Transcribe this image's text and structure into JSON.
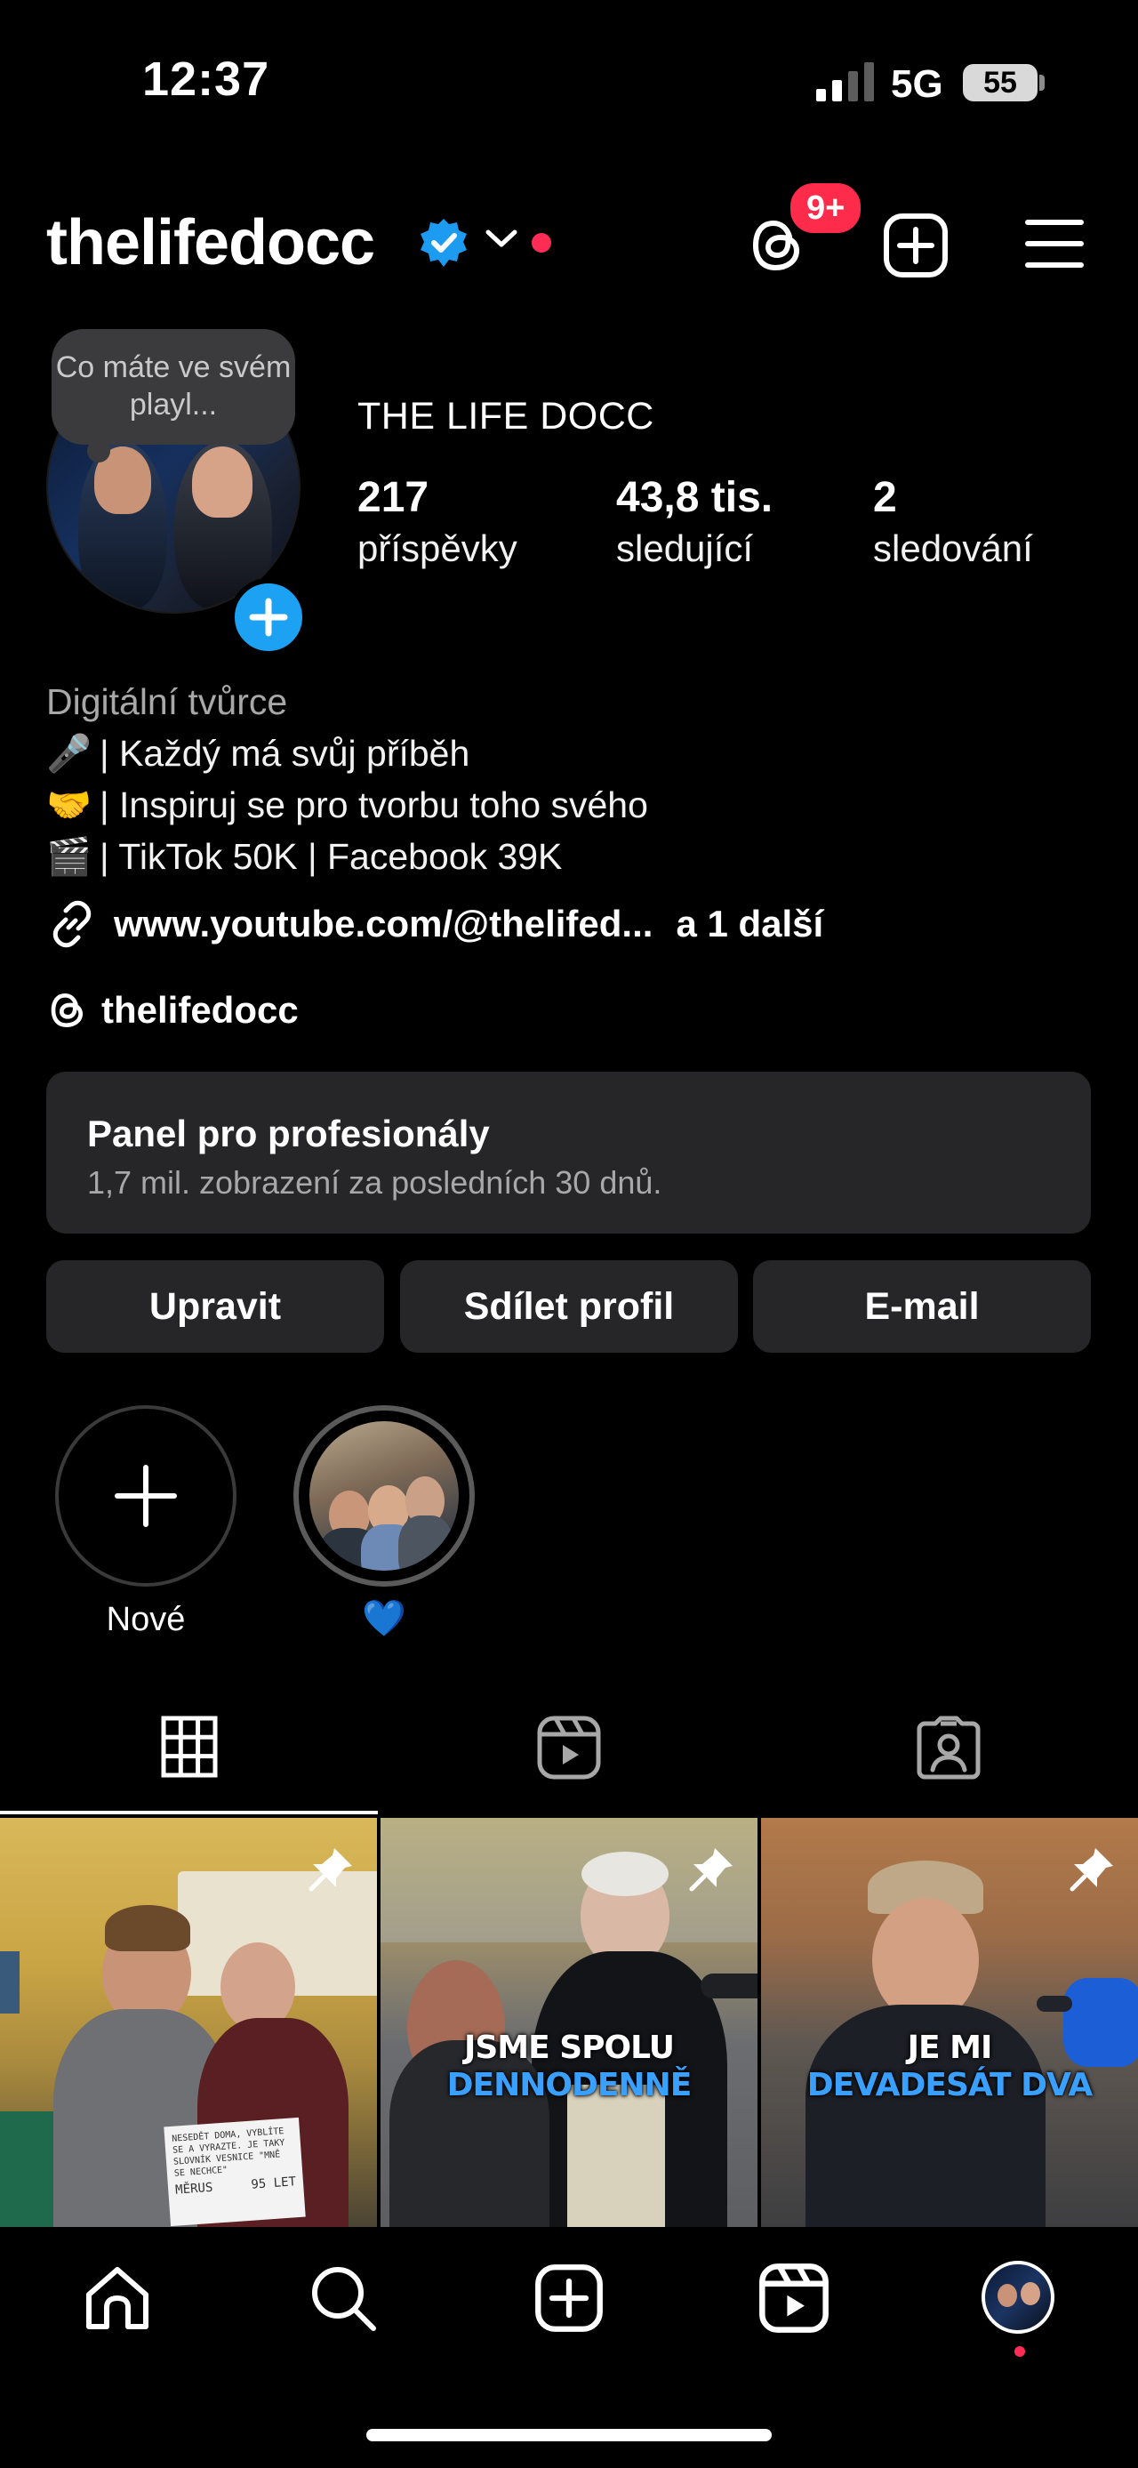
{
  "status_bar": {
    "time": "12:37",
    "network": "5G",
    "battery": "55"
  },
  "header": {
    "username": "thelifedocc",
    "notifications_badge": "9+"
  },
  "profile": {
    "note": "Co máte ve svém playl...",
    "display_name": "THE LIFE DOCC",
    "stats": [
      {
        "value": "217",
        "label": "příspěvky"
      },
      {
        "value": "43,8 tis.",
        "label": "sledující"
      },
      {
        "value": "2",
        "label": "sledování"
      }
    ]
  },
  "bio": {
    "category": "Digitální tvůrce",
    "lines": [
      {
        "emoji": "🎤",
        "text": "| Každý má svůj příběh"
      },
      {
        "emoji": "🤝",
        "text": "| Inspiruj se pro tvorbu toho svého"
      },
      {
        "emoji": "🎬",
        "text": "| TikTok 50K | Facebook 39K"
      }
    ],
    "link": "www.youtube.com/@thelifed...",
    "link_more": "a 1 další",
    "threads_handle": "thelifedocc"
  },
  "pro_panel": {
    "title": "Panel pro profesionály",
    "subtitle": "1,7 mil. zobrazení za posledních 30 dnů."
  },
  "buttons": {
    "edit": "Upravit",
    "share": "Sdílet profil",
    "email": "E-mail"
  },
  "highlights": [
    {
      "label": "Nové"
    },
    {
      "label": "💙"
    }
  ],
  "posts": [
    {
      "caption_top": "",
      "caption_bottom": "",
      "sign_text": "NESEDĚT DOMA, VYBLÍTE SE A VYRAZTE. JE TAKY SLOVNÍK VESNICE \"MNĚ SE NECHCE\"",
      "sign_name": "MĚRUS",
      "sign_age": "95 LET"
    },
    {
      "caption_top": "JSME SPOLU",
      "caption_bottom": "DENNODENNĚ"
    },
    {
      "caption_top": "JE MI",
      "caption_bottom": "DEVADESÁT DVA"
    }
  ],
  "icons": {
    "verified": "verified-badge-icon",
    "threads": "threads-icon",
    "create": "plus-square-icon",
    "menu": "hamburger-icon",
    "link": "link-icon",
    "grid": "grid-icon",
    "reels": "reels-icon",
    "tagged": "tagged-icon",
    "pin": "pin-icon",
    "home": "home-icon",
    "search": "search-icon"
  },
  "colors": {
    "accent_blue": "#1da1f2",
    "badge_red": "#ff2b4b",
    "panel_bg": "#262628"
  }
}
